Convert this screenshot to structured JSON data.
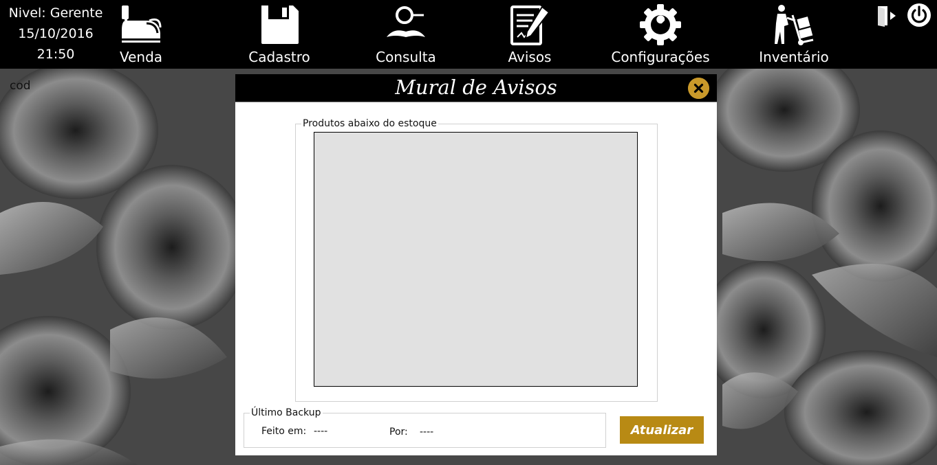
{
  "session": {
    "level": "Nivel: Gerente",
    "date": "15/10/2016",
    "time": "21:50"
  },
  "nav": [
    {
      "label": "Venda",
      "icon": "cash-register-icon"
    },
    {
      "label": "Cadastro",
      "icon": "floppy-disk-icon"
    },
    {
      "label": "Consulta",
      "icon": "magnifier-mustache-icon"
    },
    {
      "label": "Avisos",
      "icon": "notepad-pen-icon"
    },
    {
      "label": "Configurações",
      "icon": "gear-wrench-icon"
    },
    {
      "label": "Inventário",
      "icon": "hand-truck-icon"
    }
  ],
  "top_actions": {
    "logout_icon": "exit-door-icon",
    "power_icon": "power-icon"
  },
  "background": {
    "cod_label": "cod"
  },
  "modal": {
    "title": "Mural de Avisos",
    "close_icon": "close-icon",
    "stock_group_label": "Produtos abaixo do estoque",
    "backup_group_label": "Último Backup",
    "done_at_label": "Feito em:",
    "done_at_value": "----",
    "by_label": "Por:",
    "by_value": "----",
    "update_button": "Atualizar"
  },
  "colors": {
    "accent_gold": "#b88a14",
    "close_gold": "#c9992a",
    "topbar": "#000000",
    "list_bg": "#e1e1e1"
  }
}
